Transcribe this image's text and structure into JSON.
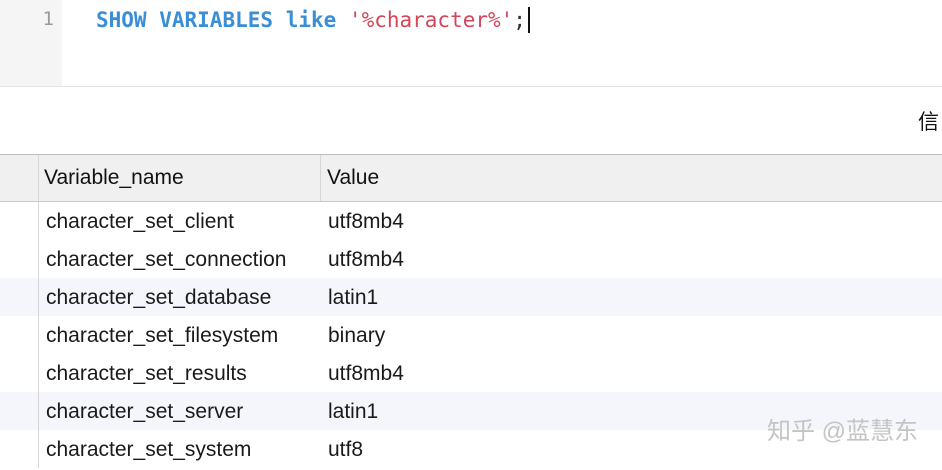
{
  "editor": {
    "line_number": "1",
    "code": {
      "keyword1": "SHOW",
      "keyword2": "VARIABLES",
      "keyword3": "like",
      "string": "'%character%'",
      "terminator": ";"
    }
  },
  "info_bar": {
    "tab_label": "信"
  },
  "grid": {
    "columns": [
      "Variable_name",
      "Value"
    ],
    "rows": [
      {
        "name": "character_set_client",
        "value": "utf8mb4"
      },
      {
        "name": "character_set_connection",
        "value": "utf8mb4"
      },
      {
        "name": "character_set_database",
        "value": "latin1"
      },
      {
        "name": "character_set_filesystem",
        "value": "binary"
      },
      {
        "name": "character_set_results",
        "value": "utf8mb4"
      },
      {
        "name": "character_set_server",
        "value": "latin1"
      },
      {
        "name": "character_set_system",
        "value": "utf8"
      }
    ]
  },
  "watermark": "知乎 @蓝慧东"
}
